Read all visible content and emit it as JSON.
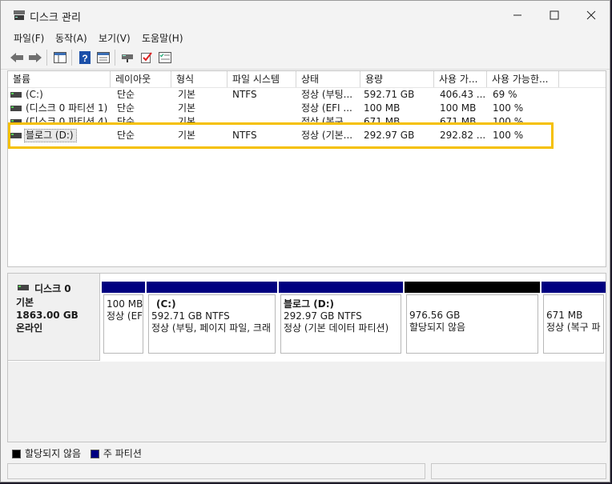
{
  "window": {
    "title": "디스크 관리"
  },
  "menu": [
    "파일(F)",
    "동작(A)",
    "보기(V)",
    "도움말(H)"
  ],
  "columns": [
    "볼륨",
    "레이아웃",
    "형식",
    "파일 시스템",
    "상태",
    "용량",
    "사용 가...",
    "사용 가능한..."
  ],
  "volumes": [
    {
      "name": "(C:)",
      "layout": "단순",
      "type": "기본",
      "fs": "NTFS",
      "status": "정상 (부팅...",
      "capacity": "592.71 GB",
      "free": "406.43 ...",
      "pct": "69 %"
    },
    {
      "name": "(디스크 0 파티션 1)",
      "layout": "단순",
      "type": "기본",
      "fs": "",
      "status": "정상 (EFI ...",
      "capacity": "100 MB",
      "free": "100 MB",
      "pct": "100 %"
    },
    {
      "name": "(디스크 0 파티션 4)",
      "layout": "단순",
      "type": "기본",
      "fs": "",
      "status": "정상 (복구...",
      "capacity": "671 MB",
      "free": "671 MB",
      "pct": "100 %"
    },
    {
      "name": "블로그 (D:)",
      "layout": "단순",
      "type": "기본",
      "fs": "NTFS",
      "status": "정상 (기본...",
      "capacity": "292.97 GB",
      "free": "292.82 ...",
      "pct": "100 %"
    }
  ],
  "disk": {
    "name": "디스크 0",
    "type": "기본",
    "size": "1863.00 GB",
    "state": "온라인"
  },
  "partitions": [
    {
      "l1": "100 MB",
      "l2": "정상 (EF",
      "l3": ""
    },
    {
      "l1": "(C:)",
      "l2": "592.71 GB NTFS",
      "l3": "정상 (부팅, 페이지 파일, 크래"
    },
    {
      "l1": "블로그  (D:)",
      "l2": "292.97 GB NTFS",
      "l3": "정상 (기본 데이터 파티션)"
    },
    {
      "l1": "",
      "l2": "976.56 GB",
      "l3": "할당되지 않음"
    },
    {
      "l1": "",
      "l2": "671 MB",
      "l3": "정상 (복구 파"
    }
  ],
  "legend": {
    "unallocated": "할당되지 않음",
    "primary": "주 파티션"
  },
  "colors": {
    "primary": "#000080",
    "unallocated": "#000000",
    "highlight": "#f5c000"
  }
}
